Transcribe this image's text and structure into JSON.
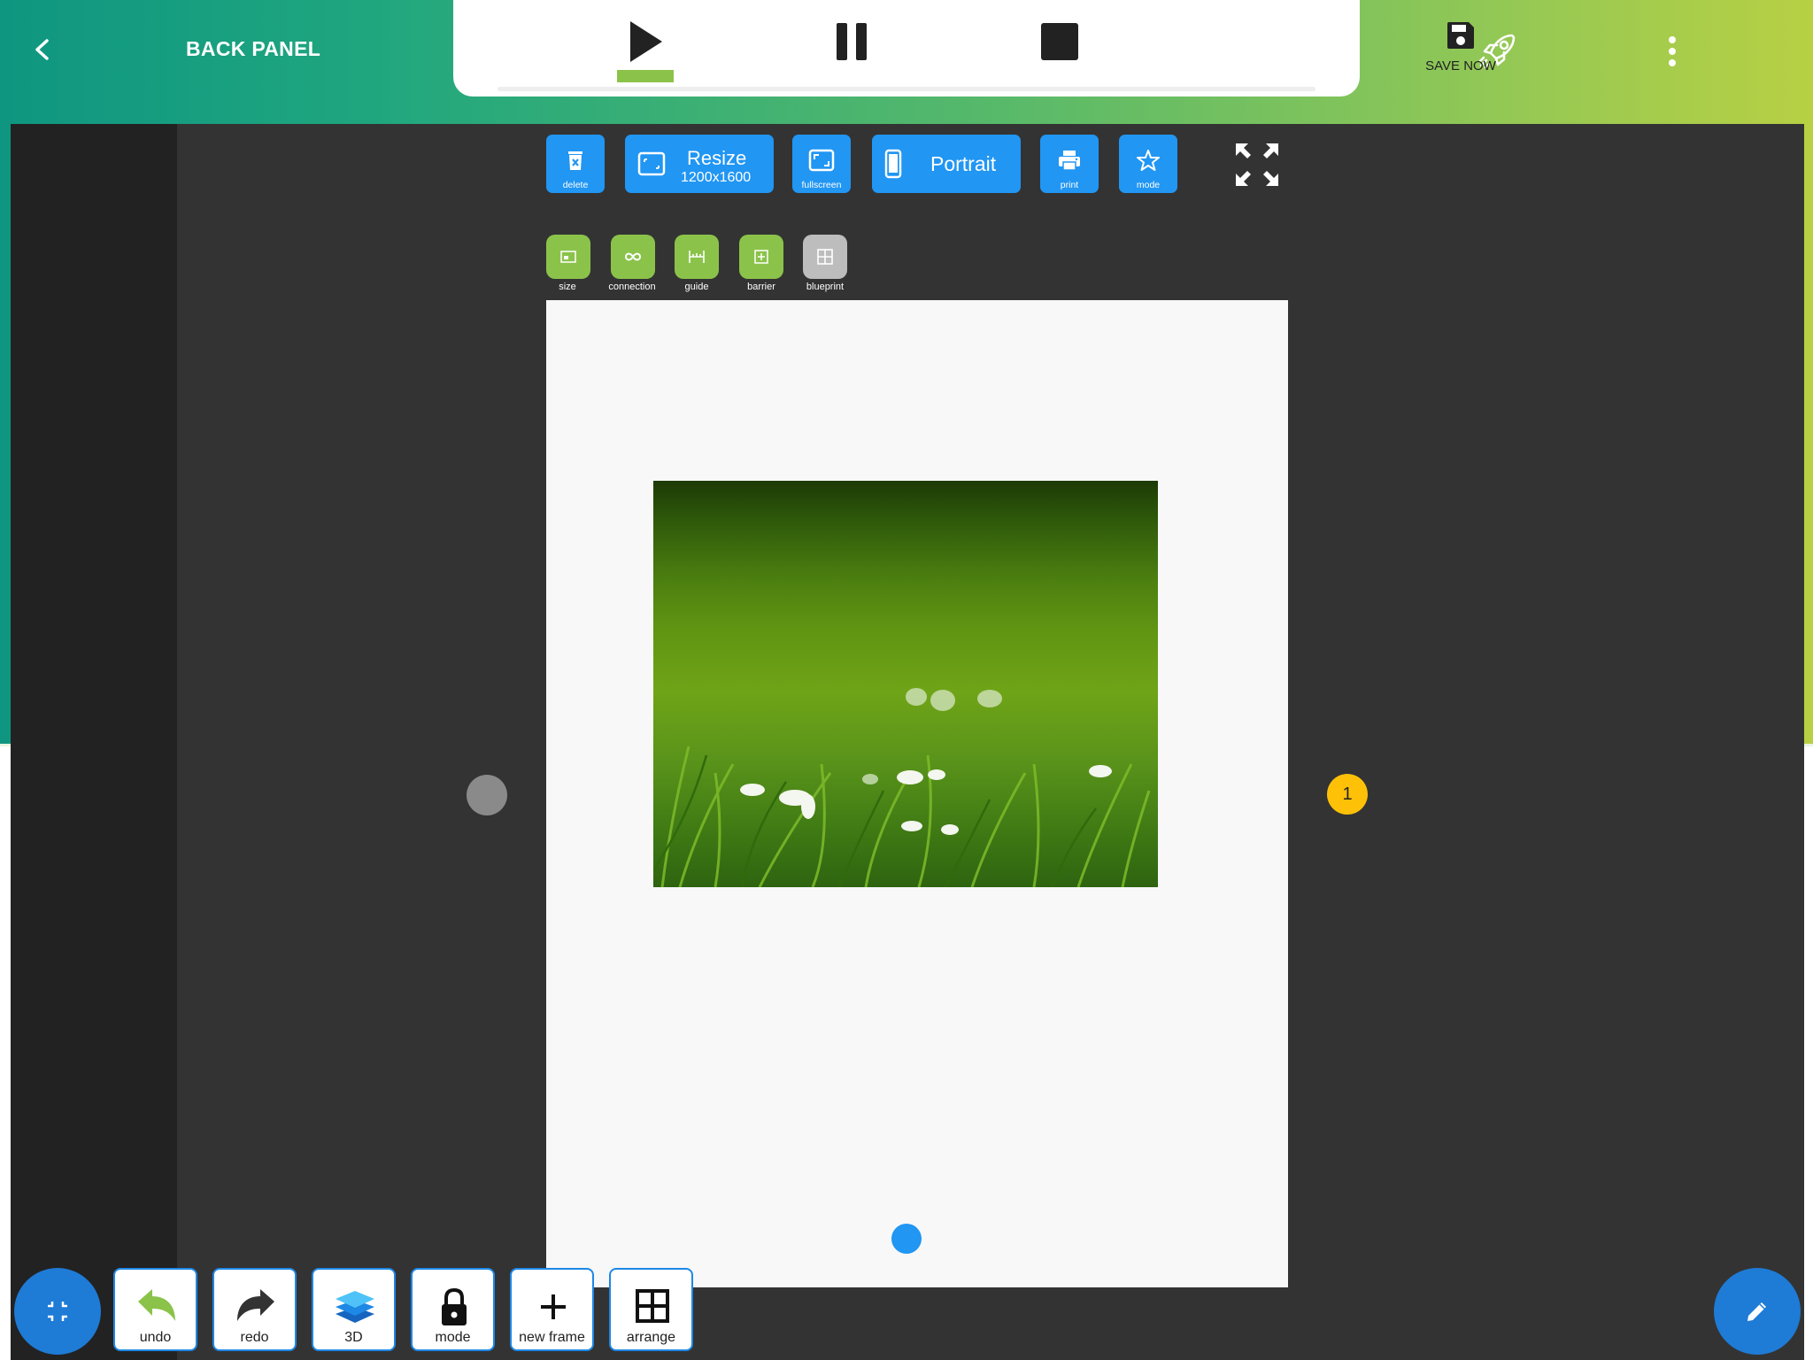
{
  "header": {
    "title": "BACK PANEL",
    "save_label": "SAVE NOW"
  },
  "playback": {
    "active": "play",
    "progress": 0.0
  },
  "toolbar": {
    "delete_label": "delete",
    "resize_label": "Resize",
    "resize_value": "1200x1600",
    "fullscreen_label": "fullscreen",
    "orientation_label": "Portrait",
    "print_label": "print",
    "mode_label": "mode"
  },
  "tools": [
    {
      "label": "size"
    },
    {
      "label": "connection"
    },
    {
      "label": "guide"
    },
    {
      "label": "barrier"
    },
    {
      "label": "blueprint"
    }
  ],
  "canvas": {
    "page_number": "1"
  },
  "bottom_bar": {
    "undo_label": "undo",
    "redo_label": "redo",
    "threed_label": "3D",
    "mode_label": "mode",
    "new_frame_label": "new frame",
    "arrange_label": "arrange"
  },
  "colors": {
    "primary": "#2196f3",
    "accent_green": "#8bc34a",
    "badge_yellow": "#ffc107",
    "fab_blue": "#1e7bd6"
  }
}
